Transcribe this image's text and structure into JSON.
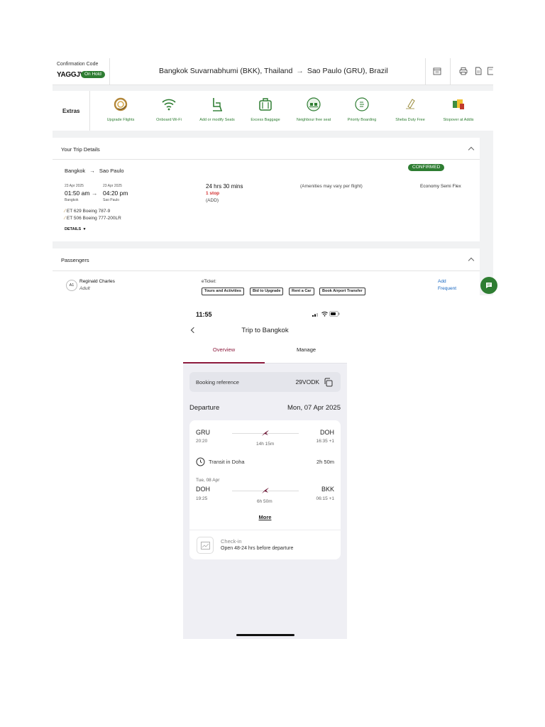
{
  "desktop": {
    "confirmation_label": "Confirmation Code",
    "confirmation_code": "YAGGJV",
    "status_badge": "On Hold",
    "route": {
      "origin": "Bangkok Suvarnabhumi (BKK), Thailand",
      "destination": "Sao Paulo (GRU), Brazil"
    },
    "top_icons": [
      "calendar-icon",
      "print-icon",
      "document-icon",
      "receipt-icon"
    ],
    "extras": {
      "label": "Extras",
      "items": [
        {
          "label": "Upgrade Flights",
          "icon": "upgrade-icon"
        },
        {
          "label": "Onboard Wi-Fi",
          "icon": "wifi-icon"
        },
        {
          "label": "Add or modify Seats",
          "icon": "seat-icon"
        },
        {
          "label": "Excess Baggage",
          "icon": "baggage-icon"
        },
        {
          "label": "Neighbour free seat",
          "icon": "neighbour-seat-icon"
        },
        {
          "label": "Priority Boarding",
          "icon": "priority-icon"
        },
        {
          "label": "Sheba Duty Free",
          "icon": "duty-free-icon"
        },
        {
          "label": "Stopover at Addis",
          "icon": "stopover-icon"
        }
      ]
    },
    "trip": {
      "header": "Your Trip Details",
      "from_city": "Bangkok",
      "to_city": "Sao Paulo",
      "status": "CONFIRMED",
      "dep_date": "23 Apr 2025",
      "dep_time": "01:50 am",
      "dep_city": "Bangkok",
      "arr_date": "23 Apr 2025",
      "arr_time": "04:20 pm",
      "arr_city": "Sao Paulo",
      "duration": "24 hrs 30 mins",
      "stops": "1 stop",
      "via": "(ADD)",
      "amenities": "(Amenities may vary per flight)",
      "fare": "Economy Semi Flex",
      "flights": [
        "ET 629 Boeing 787-9",
        "ET 506 Boeing 777-200LR"
      ],
      "details_label": "DETAILS"
    },
    "passengers": {
      "header": "Passengers",
      "badge": "A1",
      "name": "Reginald Charles",
      "type": "Adult",
      "eticket_label": "eTicket:",
      "buttons": [
        "Tours and Activities",
        "Bid to Upgrade",
        "Rent a Car",
        "Book Airport Transfer"
      ],
      "link_1": "Add",
      "link_2": "Frequent"
    }
  },
  "mobile": {
    "time": "11:55",
    "title": "Trip to Bangkok",
    "tabs": [
      "Overview",
      "Manage"
    ],
    "booking_ref_label": "Booking reference",
    "booking_ref": "29VODK",
    "departure_label": "Departure",
    "departure_date": "Mon, 07 Apr 2025",
    "leg1": {
      "from": "GRU",
      "dep": "20:20",
      "duration": "14h 15m",
      "to": "DOH",
      "arr": "16:35 +1"
    },
    "transit": {
      "label": "Transit in Doha",
      "duration": "2h 50m"
    },
    "leg2": {
      "date": "Tue, 08 Apr",
      "from": "DOH",
      "dep": "19:25",
      "duration": "6h 50m",
      "to": "BKK",
      "arr": "06:15 +1"
    },
    "more": "More",
    "checkin_title": "Check-in",
    "checkin_sub": "Open 48-24 hrs before departure"
  },
  "colors": {
    "green": "#2e7d32",
    "maroon": "#8d1b3d"
  }
}
